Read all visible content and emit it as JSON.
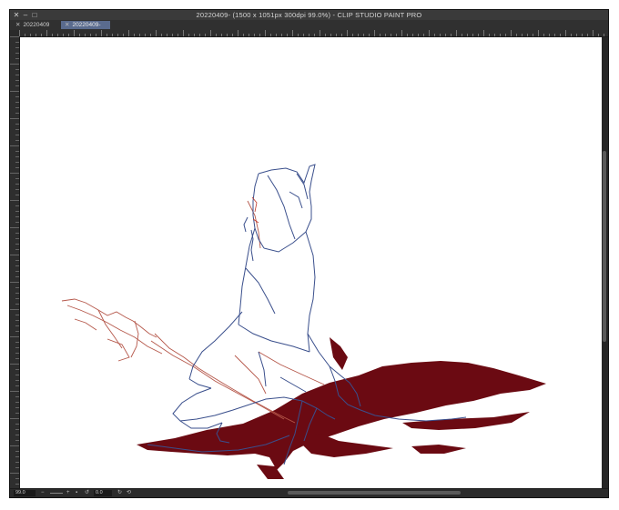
{
  "window": {
    "title": "20220409- (1500 x 1051px 300dpi 99.0%) - CLIP STUDIO PAINT PRO",
    "close_glyph": "✕",
    "minimize_glyph": "–",
    "maximize_glyph": "□"
  },
  "tabs": [
    {
      "label": "20220409",
      "close": "✕",
      "active": false
    },
    {
      "label": "20220409-",
      "close": "✕",
      "active": true
    }
  ],
  "status": {
    "zoom": "99.0",
    "rotation": "0.0"
  },
  "colors": {
    "chrome": "#2a2a2a",
    "active_tab": "#5a6b8e",
    "sketch_blue": "#3a4f8c",
    "sketch_red": "#b5574a",
    "blood": "#6b0a12"
  },
  "icons": [
    "close-icon",
    "minimize-icon",
    "maximize-icon",
    "zoom-out-icon",
    "zoom-in-icon",
    "fit-icon",
    "rotate-left-icon",
    "rotate-right-icon",
    "reset-icon"
  ]
}
